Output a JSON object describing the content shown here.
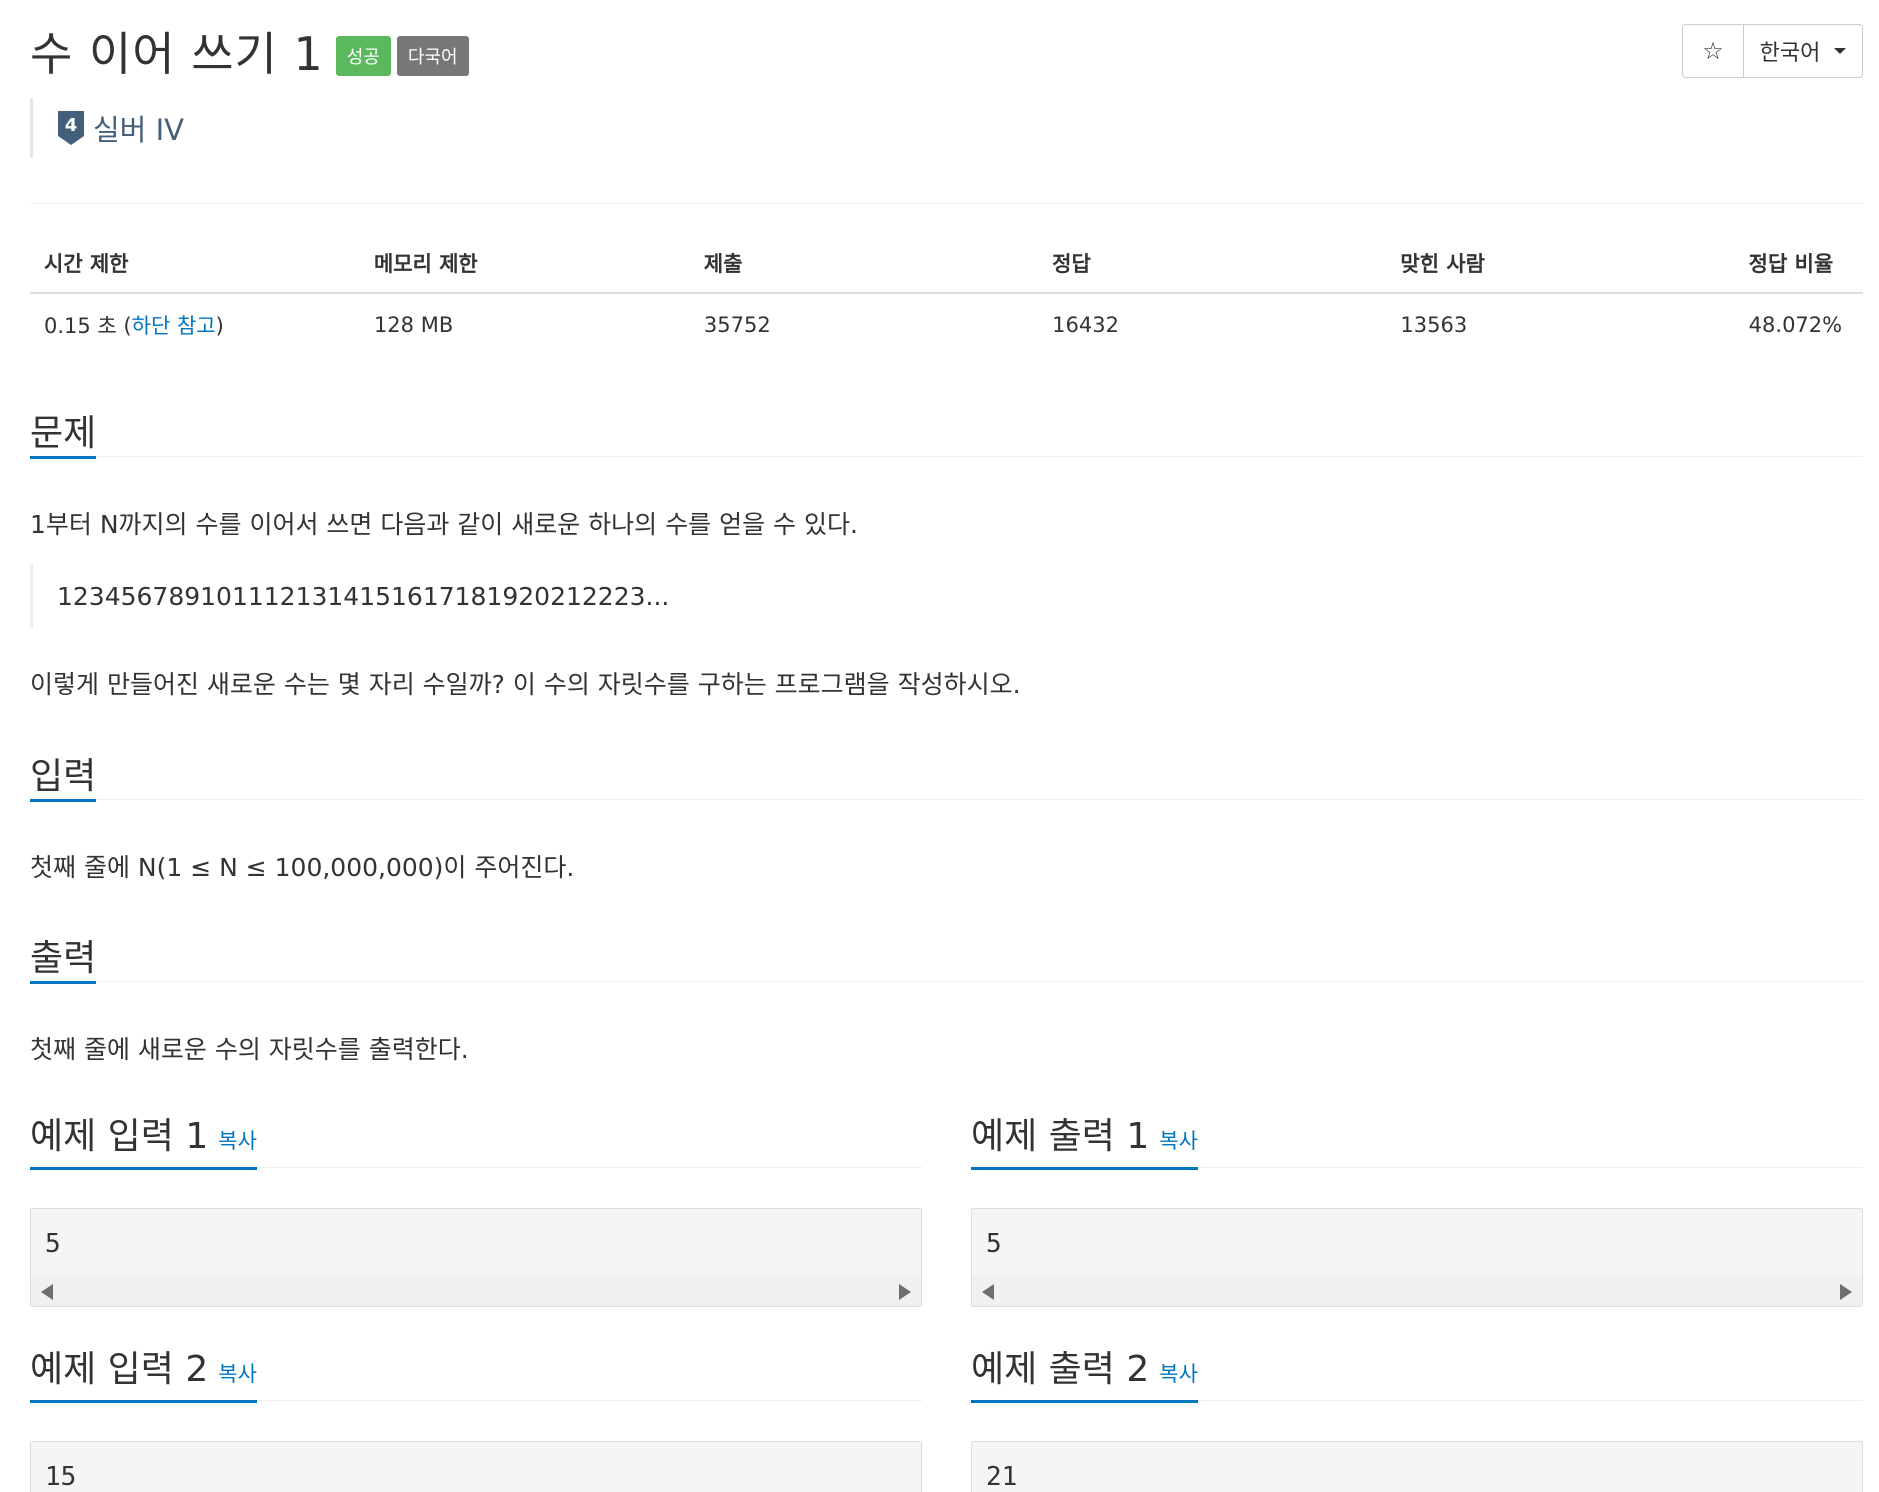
{
  "header": {
    "title": "수 이어 쓰기 1",
    "badge_success": "성공",
    "badge_lang": "다국어",
    "star_icon": "☆",
    "language_label": "한국어",
    "tier_number": "4",
    "tier_label": "실버 IV"
  },
  "stats": {
    "headers": [
      "시간 제한",
      "메모리 제한",
      "제출",
      "정답",
      "맞힌 사람",
      "정답 비율"
    ],
    "time_limit": "0.15 초 (",
    "time_limit_link": "하단 참고",
    "time_limit_close": ")",
    "memory_limit": "128 MB",
    "submissions": "35752",
    "accepted": "16432",
    "solvers": "13563",
    "ratio": "48.072%"
  },
  "problem": {
    "heading": "문제",
    "text1": "1부터 N까지의 수를 이어서 쓰면 다음과 같이 새로운 하나의 수를 얻을 수 있다.",
    "quote": "1234567891011121314151617181920212223...",
    "text2": "이렇게 만들어진 새로운 수는 몇 자리 수일까? 이 수의 자릿수를 구하는 프로그램을 작성하시오."
  },
  "input": {
    "heading": "입력",
    "text": "첫째 줄에 N(1 ≤ N ≤ 100,000,000)이 주어진다."
  },
  "output": {
    "heading": "출력",
    "text": "첫째 줄에 새로운 수의 자릿수를 출력한다."
  },
  "samples": {
    "copy_label": "복사",
    "input1_title": "예제 입력 1",
    "output1_title": "예제 출력 1",
    "input2_title": "예제 입력 2",
    "output2_title": "예제 출력 2",
    "input1_value": "5",
    "output1_value": "5",
    "input2_value": "15",
    "output2_value": "21"
  },
  "colors": {
    "accent": "#0076c0",
    "success": "#5cb85c",
    "lang_badge": "#777777",
    "tier": "#435f7a"
  }
}
